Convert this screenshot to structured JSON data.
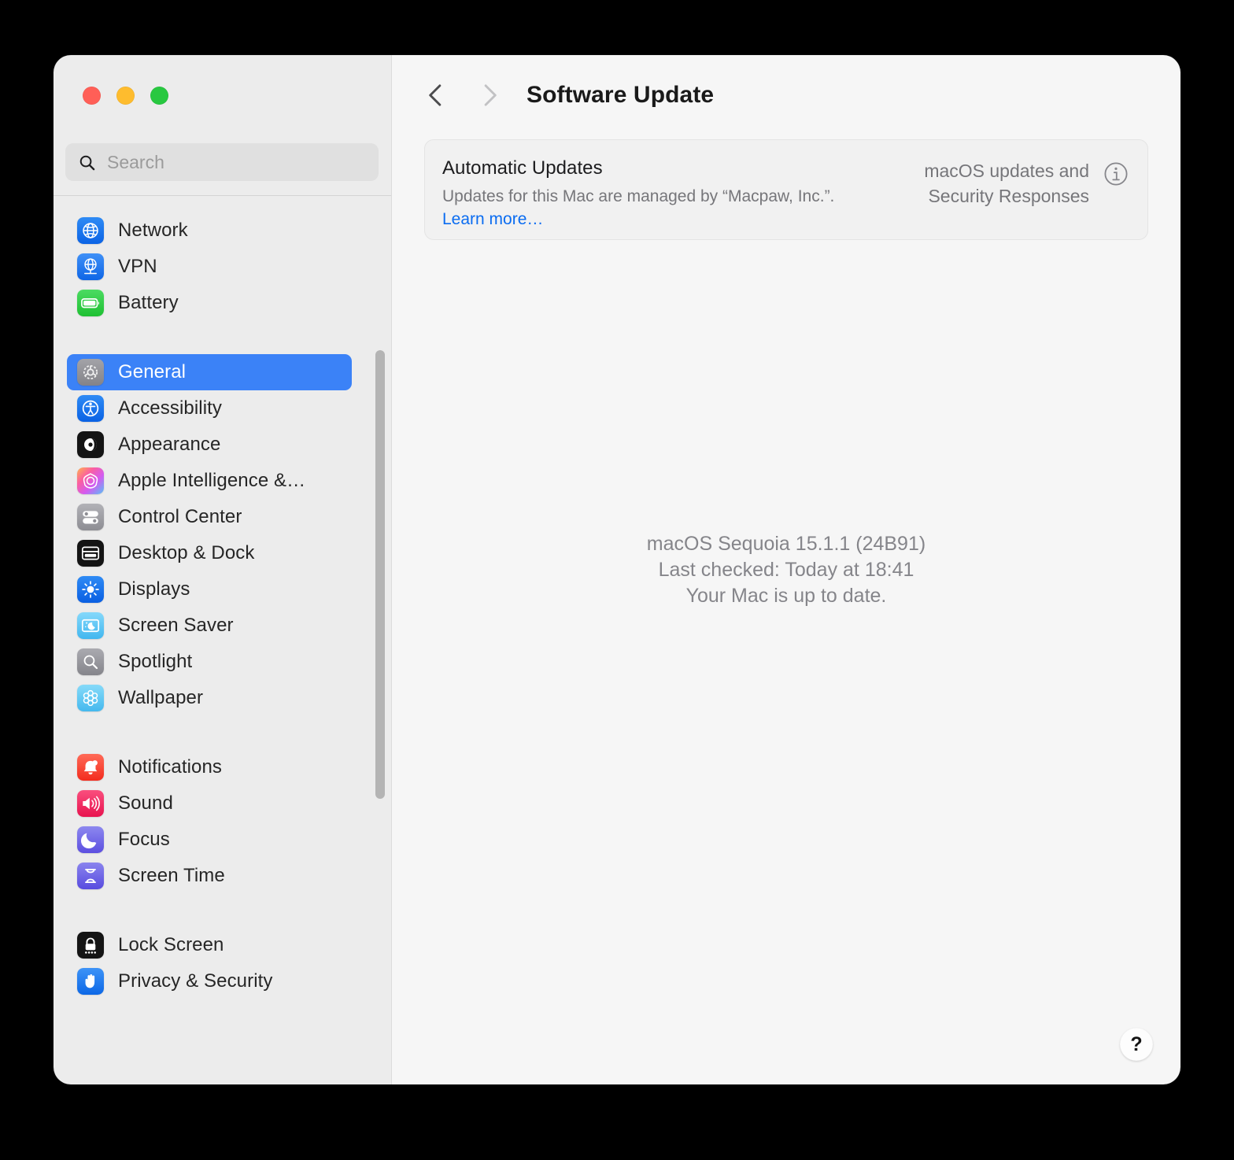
{
  "window": {
    "traffic_lights": {
      "close": "close-window",
      "minimize": "minimize-window",
      "zoom": "zoom-window"
    }
  },
  "sidebar": {
    "search": {
      "placeholder": "Search",
      "value": ""
    },
    "groups": [
      {
        "items": [
          {
            "label": "Network",
            "icon": "globe-icon",
            "selected": false
          },
          {
            "label": "VPN",
            "icon": "vpn-globe-icon",
            "selected": false
          },
          {
            "label": "Battery",
            "icon": "battery-icon",
            "selected": false
          }
        ]
      },
      {
        "items": [
          {
            "label": "General",
            "icon": "gear-icon",
            "selected": true
          },
          {
            "label": "Accessibility",
            "icon": "accessibility-icon",
            "selected": false
          },
          {
            "label": "Appearance",
            "icon": "appearance-icon",
            "selected": false
          },
          {
            "label": "Apple Intelligence &…",
            "icon": "apple-intelligence-icon",
            "selected": false
          },
          {
            "label": "Control Center",
            "icon": "control-center-icon",
            "selected": false
          },
          {
            "label": "Desktop & Dock",
            "icon": "desktop-dock-icon",
            "selected": false
          },
          {
            "label": "Displays",
            "icon": "displays-icon",
            "selected": false
          },
          {
            "label": "Screen Saver",
            "icon": "screen-saver-icon",
            "selected": false
          },
          {
            "label": "Spotlight",
            "icon": "spotlight-icon",
            "selected": false
          },
          {
            "label": "Wallpaper",
            "icon": "wallpaper-icon",
            "selected": false
          }
        ]
      },
      {
        "items": [
          {
            "label": "Notifications",
            "icon": "notifications-icon",
            "selected": false
          },
          {
            "label": "Sound",
            "icon": "sound-icon",
            "selected": false
          },
          {
            "label": "Focus",
            "icon": "focus-icon",
            "selected": false
          },
          {
            "label": "Screen Time",
            "icon": "screen-time-icon",
            "selected": false
          }
        ]
      },
      {
        "items": [
          {
            "label": "Lock Screen",
            "icon": "lock-screen-icon",
            "selected": false
          },
          {
            "label": "Privacy & Security",
            "icon": "privacy-security-icon",
            "selected": false
          }
        ]
      }
    ]
  },
  "toolbar": {
    "back_icon": "chevron-left-icon",
    "forward_icon": "chevron-right-icon",
    "title": "Software Update"
  },
  "automatic_updates_card": {
    "title": "Automatic Updates",
    "description_prefix": "Updates for this Mac are managed by “Macpaw, Inc.”. ",
    "link_label": "Learn more…",
    "value": "macOS updates and Security Responses",
    "info_icon": "info-circle-icon"
  },
  "status": {
    "version": "macOS Sequoia 15.1.1 (24B91)",
    "last_checked": "Last checked: Today at 18:41",
    "up_to_date": "Your Mac is up to date."
  },
  "help": {
    "label": "?"
  },
  "colors": {
    "accent": "#3b82f7",
    "link": "#0a6cf1",
    "sidebar_bg": "#ececec",
    "content_bg": "#f6f6f6",
    "secondary_text": "#76767a"
  }
}
